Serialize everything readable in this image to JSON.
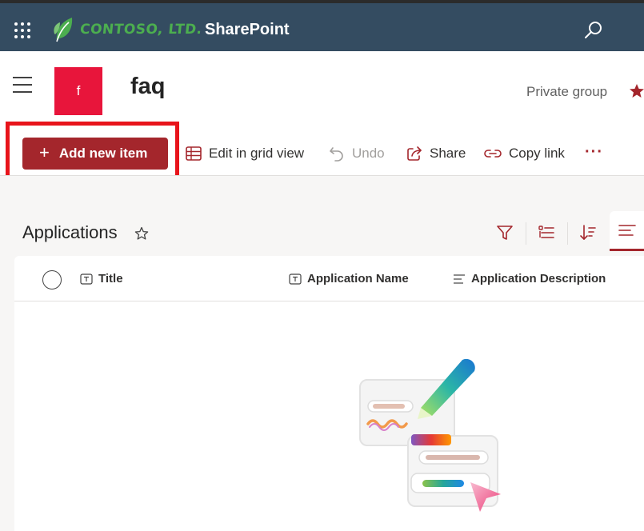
{
  "suite_bar": {
    "company": "CONTOSO, LTD.",
    "app_name": "SharePoint",
    "colors": {
      "background": "#344c61",
      "logo_green": "#4cae4f"
    },
    "icons": [
      "app-launcher-icon",
      "leaf-logo-icon",
      "search-icon"
    ]
  },
  "site_header": {
    "site_logo_letter": "f",
    "site_logo_color": "#e8153b",
    "site_title": "faq",
    "privacy": "Private group",
    "icons": [
      "hamburger-menu-icon",
      "follow-star-icon"
    ]
  },
  "command_bar": {
    "add_new_item": "Add new item",
    "edit_grid": "Edit in grid view",
    "undo": "Undo",
    "share": "Share",
    "copy_link": "Copy link",
    "more": "···",
    "accent": "#a4262c",
    "highlight_color": "#e8141b"
  },
  "list": {
    "title": "Applications",
    "columns": [
      {
        "label": "Title",
        "icon": "text-field-icon"
      },
      {
        "label": "Application Name",
        "icon": "text-field-icon"
      },
      {
        "label": "Application Description",
        "icon": "multiline-text-icon"
      }
    ],
    "tool_icons": [
      "filter-icon",
      "group-by-icon",
      "sort-icon",
      "view-options-icon"
    ]
  }
}
